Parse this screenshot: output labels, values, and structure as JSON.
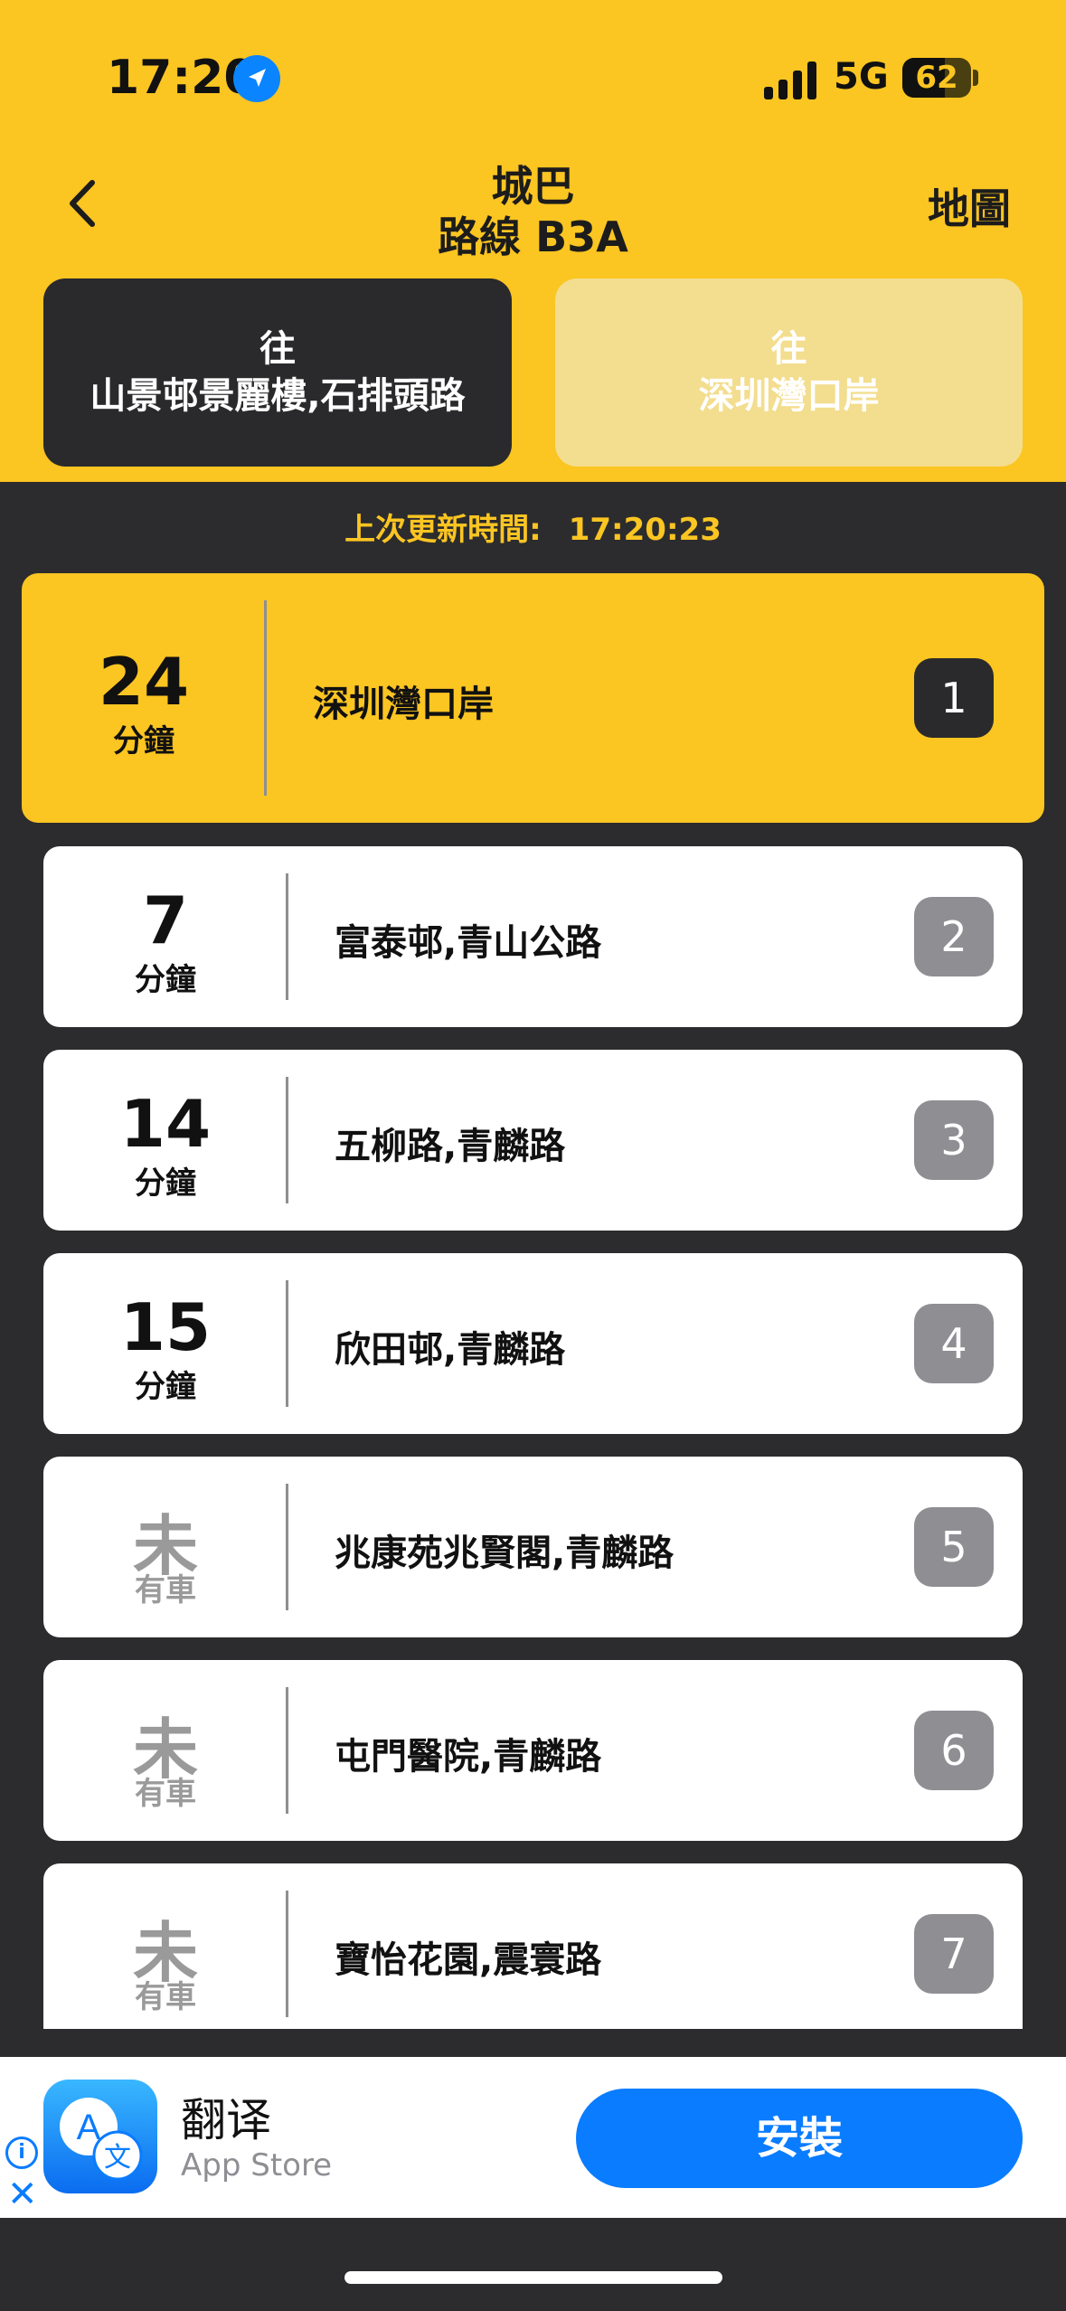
{
  "status_bar": {
    "time": "17:20",
    "network": "5G",
    "battery": "62",
    "battery_level": 0.62
  },
  "header": {
    "operator": "城巴",
    "route": "路線 B3A",
    "map_label": "地圖"
  },
  "directions": [
    {
      "prefix": "往",
      "dest": "山景邨景麗樓,石排頭路",
      "active": true
    },
    {
      "prefix": "往",
      "dest": "深圳灣口岸",
      "active": false
    }
  ],
  "updated": {
    "label": "上次更新時間:",
    "time": "17:20:23"
  },
  "stops": [
    {
      "eta": "24",
      "unit": "分鐘",
      "name": "深圳灣口岸",
      "seq": "1",
      "has_eta": true
    },
    {
      "eta": "7",
      "unit": "分鐘",
      "name": "富泰邨,青山公路",
      "seq": "2",
      "has_eta": true
    },
    {
      "eta": "14",
      "unit": "分鐘",
      "name": "五柳路,青麟路",
      "seq": "3",
      "has_eta": true
    },
    {
      "eta": "15",
      "unit": "分鐘",
      "name": "欣田邨,青麟路",
      "seq": "4",
      "has_eta": true
    },
    {
      "eta": "未",
      "unit": "有車",
      "name": "兆康苑兆賢閣,青麟路",
      "seq": "5",
      "has_eta": false
    },
    {
      "eta": "未",
      "unit": "有車",
      "name": "屯門醫院,青麟路",
      "seq": "6",
      "has_eta": false
    },
    {
      "eta": "未",
      "unit": "有車",
      "name": "寶怡花園,震寰路",
      "seq": "7",
      "has_eta": false
    }
  ],
  "ad": {
    "app_name": "翻译",
    "store": "App Store",
    "install_label": "安裝",
    "icon": "translate-app-icon"
  },
  "colors": {
    "accent": "#fbc522",
    "dark": "#2a2a2c",
    "blue": "#0a7cff"
  }
}
